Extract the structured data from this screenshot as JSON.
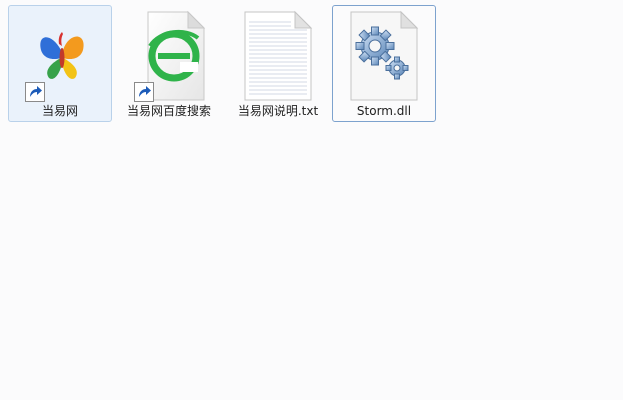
{
  "colors": {
    "background": "#fbfbfc",
    "selection_fill": "#eaf2fb",
    "selection_border": "#b9d1ea",
    "focus_border": "#7da2ce"
  },
  "files": [
    {
      "name": "当易网",
      "icon": "butterfly-icon",
      "shortcut": true,
      "selected": true
    },
    {
      "name": "当易网百度搜索",
      "icon": "browser-e-icon",
      "shortcut": true,
      "selected": false
    },
    {
      "name": "当易网说明.txt",
      "icon": "text-document-icon",
      "shortcut": false,
      "selected": false
    },
    {
      "name": "Storm.dll",
      "icon": "gears-dll-icon",
      "shortcut": false,
      "selected": false,
      "focused": true
    }
  ]
}
